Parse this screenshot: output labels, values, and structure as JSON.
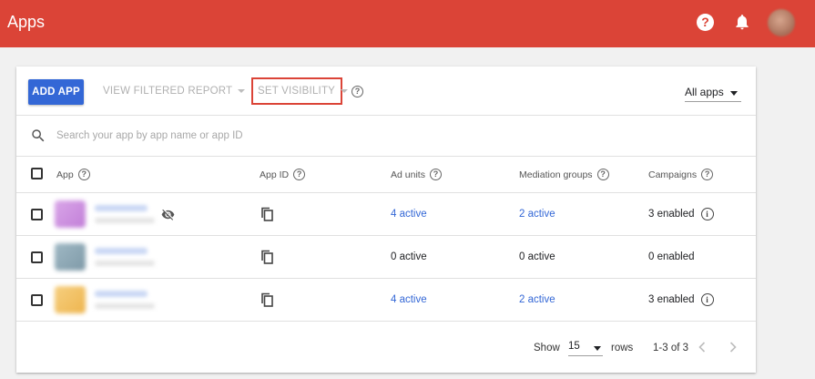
{
  "header": {
    "title": "Apps",
    "help_glyph": "?",
    "icons": [
      "help-icon",
      "notifications-bell-icon",
      "account-avatar"
    ]
  },
  "toolbar": {
    "add_app_label": "ADD APP",
    "view_filtered_report_label": "VIEW FILTERED REPORT",
    "set_visibility_label": "SET VISIBILITY",
    "filter_value": "All apps"
  },
  "search": {
    "placeholder": "Search your app by app name or app ID"
  },
  "table": {
    "columns": {
      "app": "App",
      "app_id": "App ID",
      "ad_units": "Ad units",
      "mediation_groups": "Mediation groups",
      "campaigns": "Campaigns"
    },
    "rows": [
      {
        "ad_units": "4 active",
        "mediation_groups": "2 active",
        "campaigns": "3 enabled",
        "hidden": true
      },
      {
        "ad_units": "0 active",
        "mediation_groups": "0 active",
        "campaigns": "0 enabled",
        "hidden": false
      },
      {
        "ad_units": "4 active",
        "mediation_groups": "2 active",
        "campaigns": "3 enabled",
        "hidden": false
      }
    ]
  },
  "pagination": {
    "show_label": "Show",
    "rows_per_page": "15",
    "rows_label": "rows",
    "range": "1-3 of 3"
  },
  "info_glyph": "i",
  "help_glyph": "?",
  "colors": {
    "appbar": "#db4437",
    "primary_button": "#3367d6",
    "link": "#3367d6",
    "highlight_border": "#db4437"
  }
}
